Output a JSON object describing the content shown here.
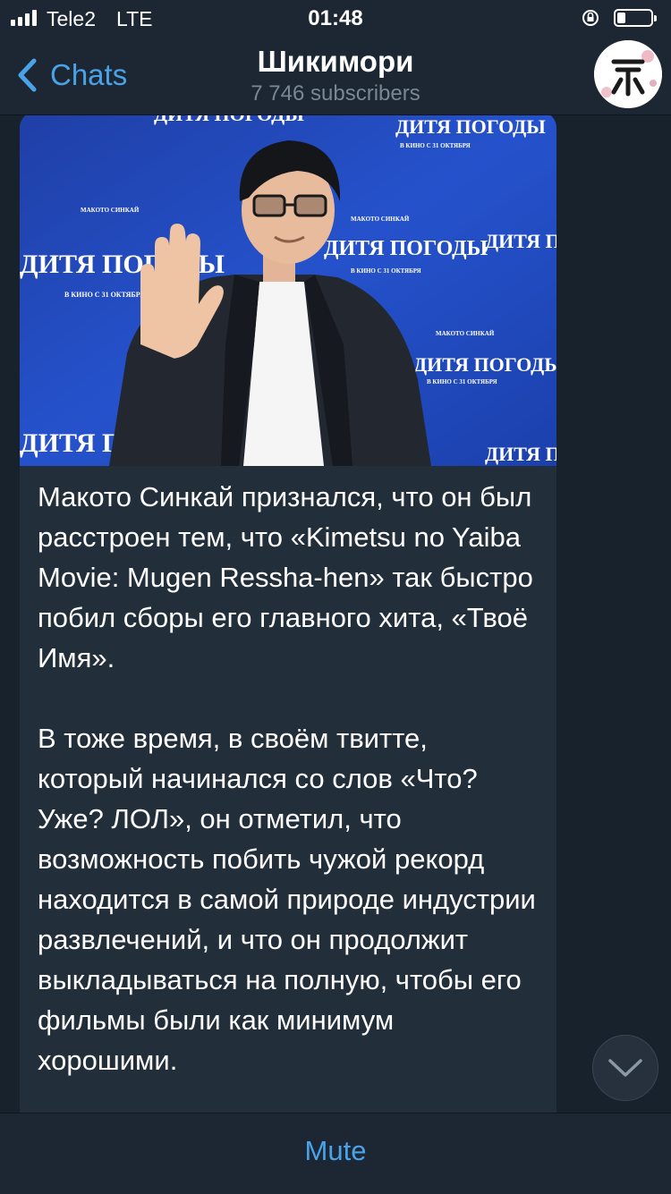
{
  "status_bar": {
    "carrier": "Tele2",
    "network": "LTE",
    "time": "01:48",
    "battery_level": 0.25
  },
  "nav": {
    "back_label": "Chats",
    "title": "Шикимори",
    "subtitle": "7 746 subscribers",
    "accent_color": "#4aa3e8"
  },
  "message": {
    "photo_banner_text": [
      "ДИТЯ ПОГОДЫ",
      "В КИНО С 31 ОКТЯБРЯ",
      "МАКОТО СИНКАЙ"
    ],
    "paragraphs": [
      "Макото Синкай признался, что он был расстроен тем, что «Kimetsu no Yaiba Movie: Mugen Ressha-hen» так быстро побил сборы его главного хита, «Твоё Имя».",
      "В тоже время, в своём твитте, который начинался со слов «Что? Уже? ЛОЛ», он отметил, что возможность побить чужой рекорд находится в самой природе индустрии развлечений, и что он продолжит выкладываться на полную, чтобы его фильмы были как минимум хорошими."
    ]
  },
  "footer": {
    "mute_label": "Mute"
  },
  "icons": [
    "signal-icon",
    "lock-rotation-icon",
    "battery-icon",
    "back-chevron-icon",
    "channel-avatar-icon",
    "chevron-down-icon"
  ]
}
